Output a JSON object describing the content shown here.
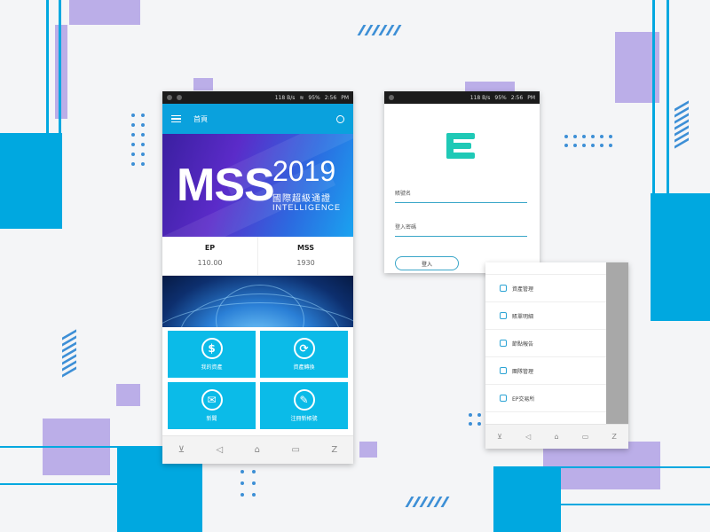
{
  "colors": {
    "accent": "#0aa1dd",
    "tile": "#0bbbe8",
    "decor_purple": "#bbaee8",
    "decor_blue": "#00a8e0"
  },
  "status_bar": {
    "speed": "118 B/s",
    "battery": "95%",
    "time": "2:56",
    "ampm": "PM"
  },
  "home": {
    "title": "首頁",
    "banner": {
      "brand": "MSS",
      "year": "2019",
      "subtitle_cn": "國際超級通證",
      "subtitle_en": "INTELLIGENCE"
    },
    "stats": [
      {
        "label": "EP",
        "value": "110.00"
      },
      {
        "label": "MSS",
        "value": "1930"
      }
    ],
    "tiles": [
      {
        "label": "我的資產",
        "icon": "dollar-icon",
        "glyph": "$"
      },
      {
        "label": "資產轉換",
        "icon": "exchange-icon",
        "glyph": "⟳"
      },
      {
        "label": "新聞",
        "icon": "mail-icon",
        "glyph": "✉"
      },
      {
        "label": "注冊新帳號",
        "icon": "register-icon",
        "glyph": "✎"
      }
    ]
  },
  "login": {
    "username_label": "賬號名",
    "password_label": "登入密碼",
    "button": "登入"
  },
  "menu": {
    "items": [
      {
        "label": "資產管理",
        "icon": "asset-icon"
      },
      {
        "label": "賬單明細",
        "icon": "bill-icon"
      },
      {
        "label": "節點報告",
        "icon": "report-icon"
      },
      {
        "label": "團隊管理",
        "icon": "team-icon"
      },
      {
        "label": "EP交易所",
        "icon": "exchange-market-icon"
      }
    ]
  },
  "nav": {
    "down": "⊻",
    "back": "◁",
    "home": "⌂",
    "recent": "▭",
    "extra": "Z"
  }
}
